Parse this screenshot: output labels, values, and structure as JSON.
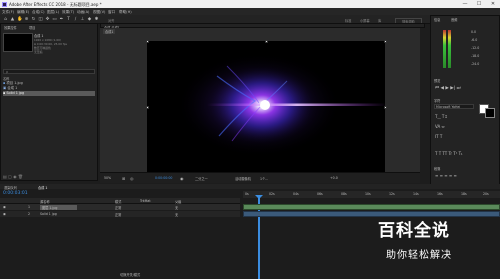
{
  "window": {
    "title": "Adobe After Effects CC 2018 - 无标题项目.aep *",
    "minimize": "—",
    "maximize": "☐",
    "close": "✕"
  },
  "menu": [
    "文件(F)",
    "编辑(E)",
    "合成(C)",
    "图层(L)",
    "效果(T)",
    "动画(A)",
    "视图(V)",
    "窗口",
    "帮助(H)"
  ],
  "toolbar": {
    "snap_label": "对齐",
    "workspaces": [
      "标准",
      "小屏幕",
      "库"
    ],
    "search_placeholder": "搜索帮助"
  },
  "project": {
    "tab_effects": "效果控件",
    "tab_project": "项目",
    "comp_name": "合成 1",
    "comp_details": [
      "1920 x 1080 (1.00)",
      "Δ 0:00:30:00, 25.00 fps",
      "数百万种颜色",
      "无压缩"
    ],
    "search_placeholder": "ρ",
    "column_name": "名称",
    "items": [
      "项目 1.jpg",
      "合成 1",
      "Solid 1 jpg"
    ]
  },
  "viewer": {
    "tab_label": "合成 合成1",
    "breadcrumb": "合成1",
    "zoom": "50%",
    "timecode": "0:00:00:00",
    "resolution": "二分之一",
    "camera": "活动摄像机",
    "views": "1个...",
    "exposure": "+0.0"
  },
  "timeline": {
    "tab_render": "渲染队列",
    "tab_comp": "合成 1",
    "timecode": "0:00:03:01",
    "col_source": "源名称",
    "col_mode": "模式",
    "col_trkmat": "TrkMat",
    "col_parent": "父级",
    "layers": [
      {
        "num": "1",
        "name": "图层 1.jpg",
        "mode": "正常",
        "parent": "无"
      },
      {
        "num": "2",
        "name": "Solid 1 jpg",
        "mode": "正常",
        "parent": "无"
      }
    ],
    "bottom_toggle": "切换开关/模式",
    "ruler": [
      "0s",
      "02s",
      "04s",
      "06s",
      "08s",
      "10s",
      "12s",
      "14s",
      "16s",
      "18s",
      "20s"
    ]
  },
  "right": {
    "tab_info": "信息",
    "tab_audio": "音频",
    "preview_label": "预览",
    "tab_character": "字符",
    "font": "Microsoft YaHei",
    "paragraph": "段落",
    "audio_values": [
      "0.0",
      "-6.0",
      "-12.0",
      "-18.0",
      "-24.0"
    ]
  },
  "watermark": {
    "line1": "百科全说",
    "line2": "助你轻松解决"
  },
  "colors": {
    "accent": "#2d8ceb",
    "timecode": "#3b8de0",
    "layer_bar": "#5a8a5a",
    "glow_core": "#ffffff",
    "glow_purple": "#8a3cff",
    "glow_blue": "#2a46d6"
  }
}
